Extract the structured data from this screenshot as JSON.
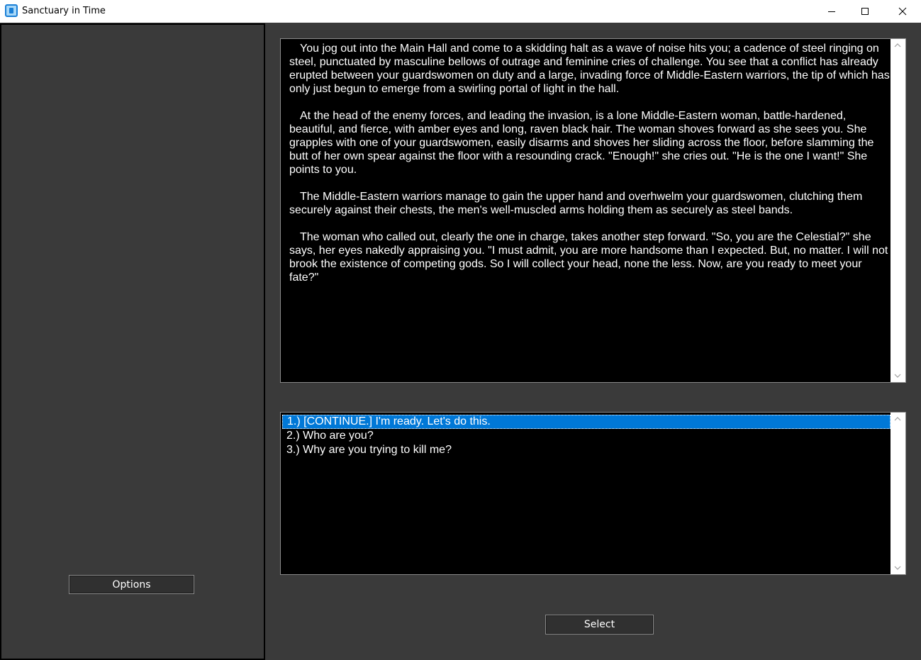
{
  "window": {
    "title": "Sanctuary in Time",
    "icons": {
      "app": "app-icon",
      "minimize": "minimize-icon",
      "maximize": "maximize-icon",
      "close": "close-icon"
    }
  },
  "sidebar": {
    "options_label": "Options"
  },
  "story": {
    "paragraphs": [
      "You jog out into the Main Hall and come to a skidding halt as a wave of noise hits you; a cadence of steel ringing on steel, punctuated by masculine bellows of outrage and feminine cries of challenge. You see that a conflict has already erupted between your guardswomen on duty and a large, invading force of Middle-Eastern warriors, the tip of which has only just begun to emerge from a swirling portal of light in the hall.",
      "At the head of the enemy forces, and leading the invasion, is a lone Middle-Eastern woman, battle-hardened, beautiful, and fierce, with amber eyes and long, raven black hair. The woman shoves forward as she sees you. She grapples with one of your guardswomen, easily disarms and shoves her sliding across the floor, before slamming the butt of her own spear against the floor with a resounding crack. \"Enough!\" she cries out. \"He is the one I want!\" She points to you.",
      "The Middle-Eastern warriors manage to gain the upper hand and overhwelm your guardswomen, clutching them securely against their chests, the men's well-muscled arms holding them as securely as steel bands.",
      "The woman who called out, clearly the one in charge, takes another step forward. \"So, you are the Celestial?\" she says, her eyes nakedly appraising you. \"I must admit, you are more handsome than I expected. But, no matter. I will not brook the existence of competing gods. So I will collect your head, none the less. Now, are you ready to meet your fate?\""
    ]
  },
  "choices": {
    "items": [
      "1.) [CONTINUE.] I'm ready. Let's do this.",
      "2.) Who are you?",
      "3.) Why are you trying to kill me?"
    ],
    "selected_index": 0,
    "select_label": "Select"
  },
  "colors": {
    "background": "#3a3a3a",
    "text_panel": "#000000",
    "selection": "#0078d7"
  }
}
